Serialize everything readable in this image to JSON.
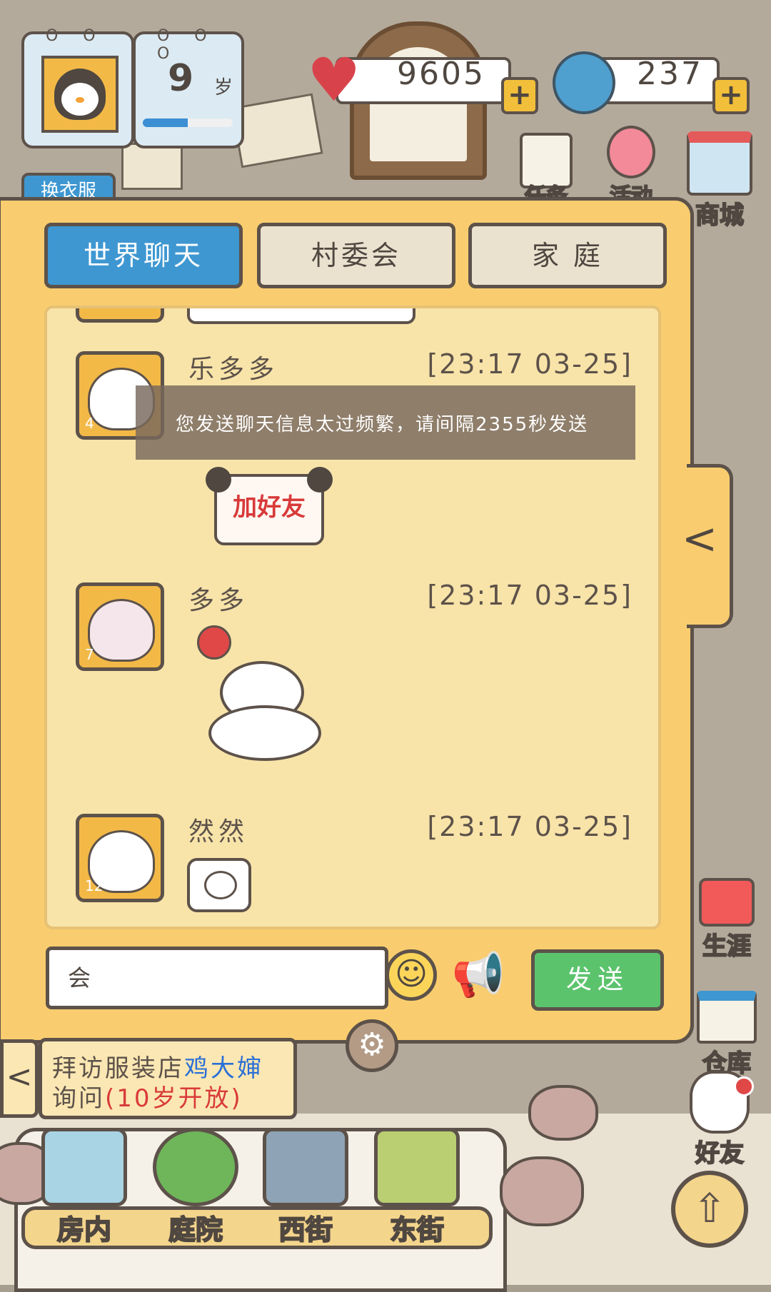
{
  "hud": {
    "age_number": "9",
    "age_unit": "岁",
    "age_progress": 0.5,
    "hearts": "9605",
    "coins": "237",
    "plus": "+"
  },
  "top_side": {
    "cloth_label": "换衣服",
    "task_label": "任务",
    "event_label": "活动",
    "shop_label": "商城"
  },
  "chat": {
    "tabs": [
      {
        "label": "世界聊天",
        "active": true
      },
      {
        "label": "村委会",
        "active": false
      },
      {
        "label": "家 庭",
        "active": false
      }
    ],
    "messages": [
      {
        "name": "乐多多",
        "time": "[23:17 03-25]",
        "level": "4",
        "sticker": "加好友"
      },
      {
        "name": "多多",
        "time": "[23:17 03-25]",
        "level": "7",
        "sticker": ""
      },
      {
        "name": "然然",
        "time": "[23:17 03-25]",
        "level": "12",
        "sticker": ""
      }
    ],
    "toast": "您发送聊天信息太过频繁，请间隔2355秒发送",
    "input_value": "会",
    "send_label": "发送",
    "collapse": "<"
  },
  "task": {
    "line1_prefix": "拜访服装店",
    "line1_name": "鸡大婶",
    "line2_prefix": "询问",
    "line2_note": "(10岁开放)",
    "arrow": "<"
  },
  "right_side": {
    "career_label": "生涯",
    "storage_label": "仓库",
    "friends_label": "好友"
  },
  "bottom_nav": [
    {
      "label": "房内"
    },
    {
      "label": "庭院"
    },
    {
      "label": "西街"
    },
    {
      "label": "东街"
    }
  ],
  "colors": {
    "panel": "#f9cd6f",
    "tab_active": "#3e97d1",
    "send": "#5cc36d",
    "heart": "#d8434b",
    "coin": "#4f9fcf",
    "task_name": "#2a6fd6",
    "task_note": "#d83a3a"
  }
}
